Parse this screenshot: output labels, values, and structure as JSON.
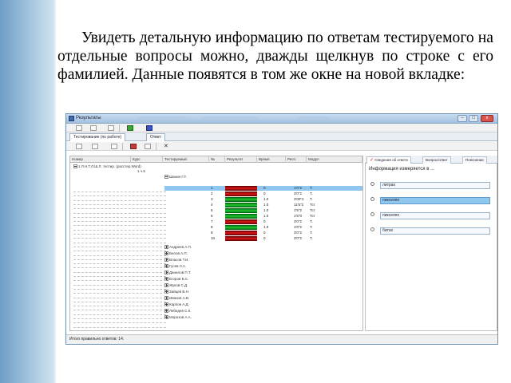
{
  "slide": {
    "text": "Увидеть детальную информацию по ответам тестируемого на отдельные вопросы можно, дважды щелкнув по строке с его фамилией. Данные появятся в том же окне на новой вкладке:"
  },
  "window": {
    "title": "Результаты",
    "controls": {
      "minimize": "–",
      "maximize": "□",
      "close": "x"
    },
    "doc_tabs": [
      "Тестирование (по работе)",
      "Ответ"
    ],
    "grid": {
      "columns": [
        "Номер",
        "Курс",
        "Тестируемый",
        "№",
        "Результат",
        "Время",
        "Респ.",
        "Модул"
      ],
      "tree_root": "1 Л.Н.Т.Л.Ш.Л. тестир. (расстер.Word)",
      "tree_sub": "1 ч.5",
      "student_top": "Шанин Г.Т.",
      "rows": [
        {
          "n": "1",
          "t": "0",
          "time": "1'0\"2",
          "r": "Т.",
          "bar": "red",
          "selected": true
        },
        {
          "n": "2",
          "t": "0",
          "time": "3'0\"2",
          "r": "Т.",
          "bar": "red",
          "selected": false
        },
        {
          "n": "3",
          "t": "1.0",
          "time": "3'00\"2",
          "r": "Т.",
          "bar": "green",
          "selected": false
        },
        {
          "n": "4",
          "t": "1.0",
          "time": "11'5\"2",
          "r": "Тст",
          "bar": "green",
          "selected": false
        },
        {
          "n": "5",
          "t": "1.0",
          "time": "1'5\"2",
          "r": "Тст",
          "bar": "green",
          "selected": false
        },
        {
          "n": "6",
          "t": "1.0",
          "time": "1'5\"0",
          "r": "Тст",
          "bar": "green",
          "selected": false
        },
        {
          "n": "7",
          "t": "0",
          "time": "3'0\"2",
          "r": "Т.",
          "bar": "red",
          "selected": false
        },
        {
          "n": "8",
          "t": "1.0",
          "time": "1'0\"2",
          "r": "Т.",
          "bar": "green",
          "selected": false
        },
        {
          "n": "9",
          "t": "0",
          "time": "3'0\"2",
          "r": "Т.",
          "bar": "red",
          "selected": false
        },
        {
          "n": "10",
          "t": "0",
          "time": "3'0\"2",
          "r": "Т.",
          "bar": "red",
          "selected": false
        }
      ],
      "students": [
        "Андреев А.П.",
        "Белов А.П.",
        "Власов Т.И.",
        "Гусев Л.А.",
        "Данилов П.Т.",
        "Егоров Б.С.",
        "Жуков С.Д.",
        "Зайцев В.Н.",
        "Иванов А.В.",
        "Карпов А.Д.",
        "Лебедев С.К.",
        "Морозов А.А."
      ]
    },
    "side_tabs": [
      "Сведения об ответе",
      "Вопрос/ответ",
      "Пояснение"
    ],
    "side": {
      "question": "Информация измеряется в ...",
      "answers": [
        {
          "label": "литрах",
          "highlighted": false
        },
        {
          "label": "пикселях",
          "highlighted": true
        },
        {
          "label": "пикселях",
          "highlighted": false
        },
        {
          "label": "битах",
          "highlighted": false
        }
      ]
    },
    "status": "Итого правильно ответов: 14."
  },
  "colors": {
    "selection": "#8fc7ee",
    "correct": "#1fc832",
    "wrong": "#e01818"
  }
}
